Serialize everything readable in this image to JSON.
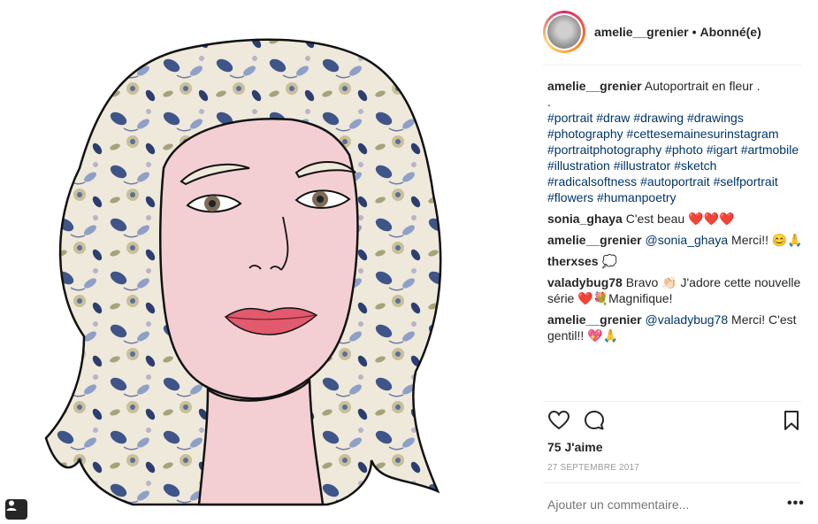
{
  "header": {
    "username": "amelie__grenier",
    "separator": "•",
    "follow_status": "Abonné(e)"
  },
  "caption": {
    "username": "amelie__grenier",
    "text": "Autoportrait en fleur .",
    "extra_line": ".",
    "hashtags": [
      "#portrait",
      "#draw",
      "#drawing",
      "#drawings",
      "#photography",
      "#cettesemainesurinstagram",
      "#portraitphotography",
      "#photo",
      "#igart",
      "#artmobile",
      "#illustration",
      "#illustrator",
      "#sketch",
      "#radicalsoftness",
      "#autoportrait",
      "#selfportrait",
      "#flowers",
      "#humanpoetry"
    ]
  },
  "comments": [
    {
      "username": "sonia_ghaya",
      "text": "C'est beau ❤️❤️❤️"
    },
    {
      "username": "amelie__grenier",
      "mention": "@sonia_ghaya",
      "text": " Merci!! 😊🙏"
    },
    {
      "username": "therxses",
      "text": "💭"
    },
    {
      "username": "valadybug78",
      "text": "Bravo 👏🏻 J'adore cette nouvelle série ❤️💐Magnifique!"
    },
    {
      "username": "amelie__grenier",
      "mention": "@valadybug78",
      "text": " Merci! C'est gentil!! 💖🙏"
    }
  ],
  "likes": "75 J'aime",
  "date": "27 SEPTEMBRE 2017",
  "add_comment_placeholder": "Ajouter un commentaire...",
  "more_label": "•••",
  "icons": {
    "like": "heart-icon",
    "comment": "comment-icon",
    "save": "bookmark-icon",
    "tagged": "user-tag-icon"
  },
  "colors": {
    "skin": "#f3cfd4",
    "lips": "#e25a6d",
    "link": "#003569",
    "muted": "#999999"
  }
}
